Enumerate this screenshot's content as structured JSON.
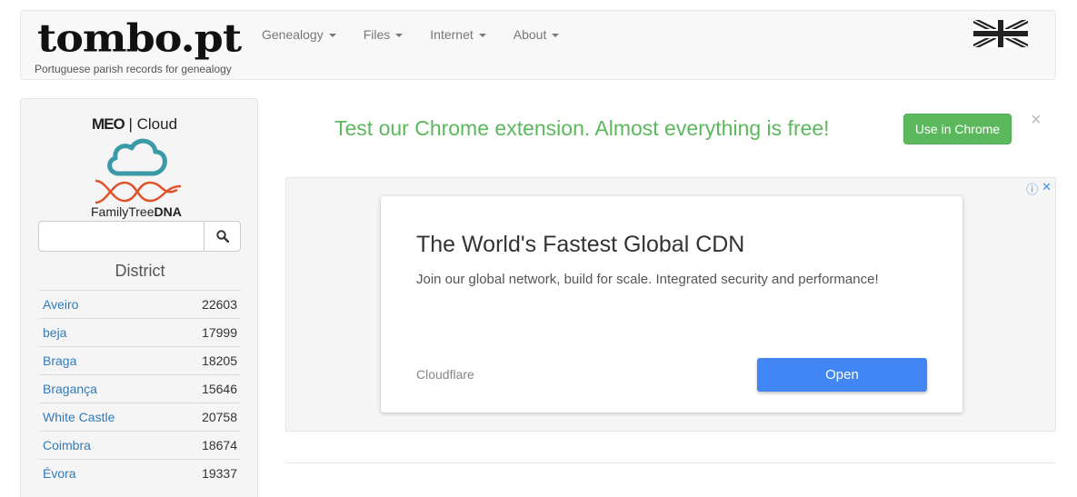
{
  "brand": {
    "logo_text": "tombo.pt",
    "tagline": "Portuguese parish records for genealogy"
  },
  "nav": {
    "items": [
      {
        "label": "Genealogy"
      },
      {
        "label": "Files"
      },
      {
        "label": "Internet"
      },
      {
        "label": "About"
      }
    ],
    "language_flag": "uk-flag-icon"
  },
  "sidebar": {
    "sponsor_meo": {
      "brand": "MEO",
      "separator": "|",
      "product": "Cloud"
    },
    "sponsor_ftdna": {
      "part1": "FamilyTree",
      "part2": "DNA"
    },
    "search": {
      "value": "",
      "placeholder": ""
    },
    "district_title": "District",
    "districts": [
      {
        "name": "Aveiro",
        "count": "22603"
      },
      {
        "name": "beja",
        "count": "17999"
      },
      {
        "name": "Braga",
        "count": "18205"
      },
      {
        "name": "Bragança",
        "count": "15646"
      },
      {
        "name": "White Castle",
        "count": "20758"
      },
      {
        "name": "Coimbra",
        "count": "18674"
      },
      {
        "name": "Évora",
        "count": "19337"
      }
    ]
  },
  "promo": {
    "text": "Test our Chrome extension. Almost everything is free!",
    "button_label": "Use in Chrome",
    "close_label": "×"
  },
  "ad": {
    "headline": "The World's Fastest Global CDN",
    "description": "Join our global network, build for scale. Integrated security and performance!",
    "advertiser": "Cloudflare",
    "cta_label": "Open",
    "info_glyph": "ⓘ",
    "close_glyph": "✕"
  },
  "colors": {
    "promo_green": "#5cb85c",
    "link_blue": "#337ab7",
    "ad_button_blue": "#4285f4",
    "cloud_teal": "#3b9aa8",
    "dna_orange": "#e0522a"
  }
}
